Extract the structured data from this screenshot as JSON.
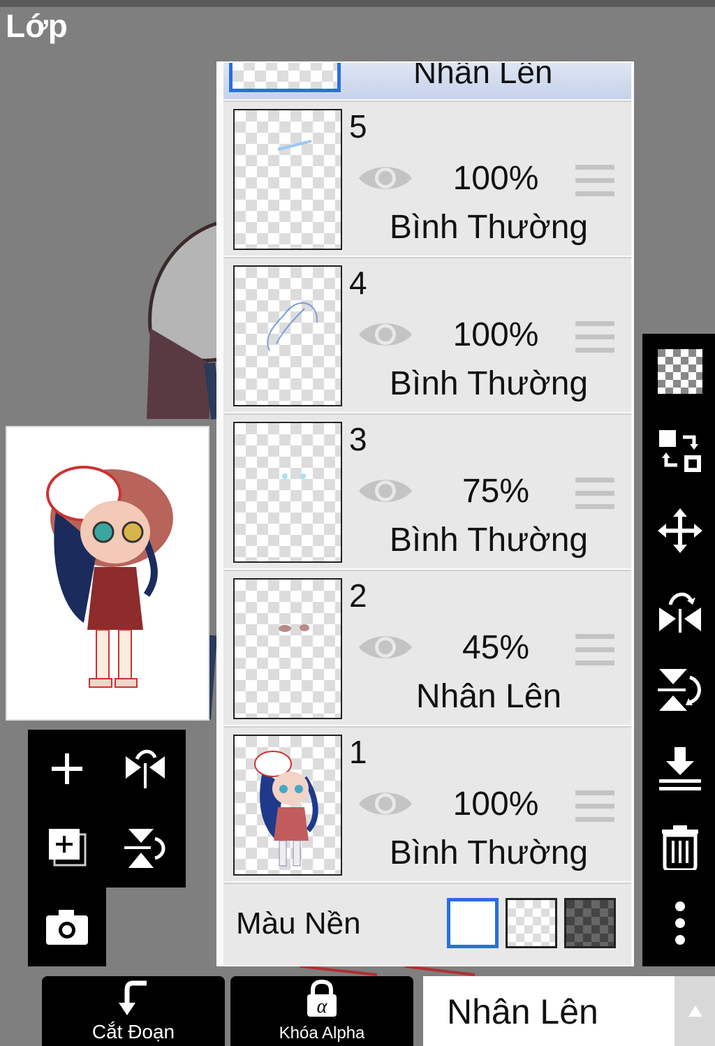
{
  "header": {
    "title": "Lớp"
  },
  "panel": {
    "top_partial": {
      "blend_mode": "Nhân Lên"
    },
    "layers": [
      {
        "number": "5",
        "opacity": "100%",
        "blend_mode": "Bình Thường",
        "visible_icon": "eye-icon"
      },
      {
        "number": "4",
        "opacity": "100%",
        "blend_mode": "Bình Thường",
        "visible_icon": "eye-icon"
      },
      {
        "number": "3",
        "opacity": "75%",
        "blend_mode": "Bình Thường",
        "visible_icon": "eye-icon"
      },
      {
        "number": "2",
        "opacity": "45%",
        "blend_mode": "Nhân Lên",
        "visible_icon": "eye-icon"
      },
      {
        "number": "1",
        "opacity": "100%",
        "blend_mode": "Bình Thường",
        "visible_icon": "eye-icon"
      }
    ],
    "background_color": {
      "label": "Màu Nền",
      "options": [
        "white",
        "transparent",
        "dark-checker"
      ],
      "selected": "white"
    }
  },
  "left_tools": [
    "add-layer-icon",
    "flip-horizontal-icon",
    "add-copy-icon",
    "flip-vertical-icon",
    "camera-icon"
  ],
  "right_tools": [
    "transparency-icon",
    "swap-icon",
    "move-icon",
    "mirror-horizontal-icon",
    "mirror-vertical-icon",
    "merge-down-icon",
    "trash-icon",
    "more-icon"
  ],
  "bottom": {
    "clip_label": "Cắt Đoạn",
    "alpha_lock_label": "Khóa Alpha",
    "blend_select": "Nhân Lên"
  },
  "colors": {
    "accent": "#2a6fde",
    "toolbar": "#000000",
    "background": "#7f7f7f"
  }
}
